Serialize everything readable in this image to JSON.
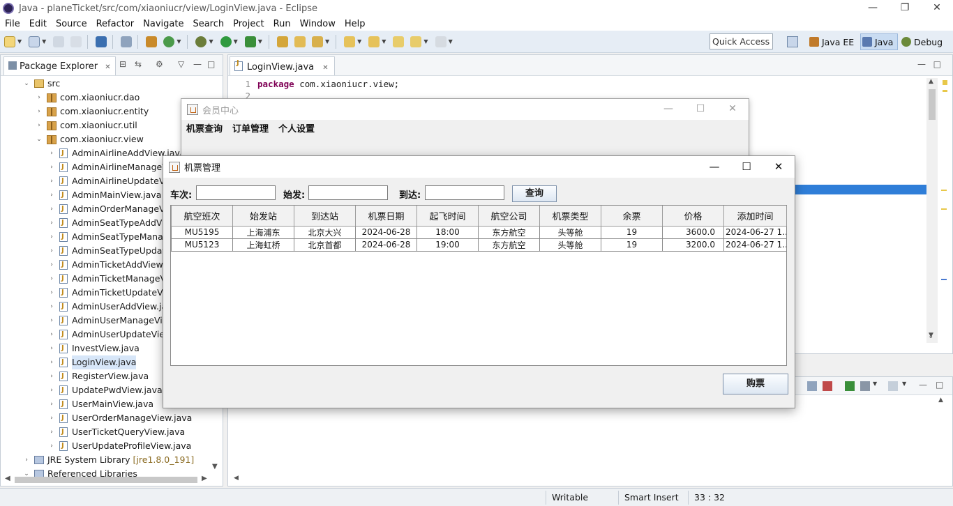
{
  "window": {
    "title": "Java - planeTicket/src/com/xiaoniucr/view/LoginView.java - Eclipse",
    "min_symbol": "—",
    "restore_symbol": "❐",
    "close_symbol": "✕"
  },
  "menu": [
    "File",
    "Edit",
    "Source",
    "Refactor",
    "Navigate",
    "Search",
    "Project",
    "Run",
    "Window",
    "Help"
  ],
  "toolbar": {
    "quick_access": "Quick Access",
    "perspectives": [
      {
        "label": "Java EE",
        "active": false
      },
      {
        "label": "Java",
        "active": true
      },
      {
        "label": "Debug",
        "active": false
      }
    ]
  },
  "package_explorer": {
    "tab_label": "Package Explorer",
    "tree": [
      {
        "label": "src",
        "kind": "src",
        "expanded": true
      },
      {
        "label": "com.xiaoniucr.dao",
        "kind": "pkg"
      },
      {
        "label": "com.xiaoniucr.entity",
        "kind": "pkg"
      },
      {
        "label": "com.xiaoniucr.util",
        "kind": "pkg"
      },
      {
        "label": "com.xiaoniucr.view",
        "kind": "pkg",
        "expanded": true
      },
      {
        "label": "AdminAirlineAddView.java",
        "kind": "java"
      },
      {
        "label": "AdminAirlineManageV",
        "kind": "java"
      },
      {
        "label": "AdminAirlineUpdateVi",
        "kind": "java"
      },
      {
        "label": "AdminMainView.java",
        "kind": "java"
      },
      {
        "label": "AdminOrderManageVi",
        "kind": "java"
      },
      {
        "label": "AdminSeatTypeAddVi",
        "kind": "java"
      },
      {
        "label": "AdminSeatTypeManag",
        "kind": "java"
      },
      {
        "label": "AdminSeatTypeUpdat",
        "kind": "java"
      },
      {
        "label": "AdminTicketAddView.j",
        "kind": "java"
      },
      {
        "label": "AdminTicketManageV",
        "kind": "java"
      },
      {
        "label": "AdminTicketUpdateVi",
        "kind": "java"
      },
      {
        "label": "AdminUserAddView.ja",
        "kind": "java"
      },
      {
        "label": "AdminUserManageVie",
        "kind": "java"
      },
      {
        "label": "AdminUserUpdateView",
        "kind": "java"
      },
      {
        "label": "InvestView.java",
        "kind": "java"
      },
      {
        "label": "LoginView.java",
        "kind": "java",
        "selected": true
      },
      {
        "label": "RegisterView.java",
        "kind": "java"
      },
      {
        "label": "UpdatePwdView.java",
        "kind": "java"
      },
      {
        "label": "UserMainView.java",
        "kind": "java"
      },
      {
        "label": "UserOrderManageView.java",
        "kind": "java"
      },
      {
        "label": "UserTicketQueryView.java",
        "kind": "java"
      },
      {
        "label": "UserUpdateProfileView.java",
        "kind": "java"
      },
      {
        "label": "JRE System Library",
        "version": "[jre1.8.0_191]",
        "kind": "lib"
      },
      {
        "label": "Referenced Libraries",
        "kind": "lib",
        "expanded": true
      }
    ]
  },
  "editor": {
    "tab_label": "LoginView.java",
    "lines": [
      {
        "num": "1",
        "keyword": "package",
        "rest": " com.xiaoniucr.view;"
      },
      {
        "num": "2",
        "keyword": "",
        "rest": ""
      }
    ]
  },
  "status": {
    "writable": "Writable",
    "insert_mode": "Smart Insert",
    "position": "33 : 32"
  },
  "member_window": {
    "title": "会员中心",
    "menu": [
      "机票查询",
      "订单管理",
      "个人设置"
    ]
  },
  "ticket_dialog": {
    "title": "机票管理",
    "search": {
      "train_label": "车次:",
      "train_value": "",
      "from_label": "始发:",
      "from_value": "",
      "to_label": "到达:",
      "to_value": "",
      "query_button": "查询"
    },
    "table": {
      "columns": [
        "航空班次",
        "始发站",
        "到达站",
        "机票日期",
        "起飞时间",
        "航空公司",
        "机票类型",
        "余票",
        "价格",
        "添加时间"
      ],
      "rows": [
        [
          "MU5195",
          "上海浦东",
          "北京大兴",
          "2024-06-28",
          "18:00",
          "东方航空",
          "头等舱",
          "19",
          "3600.0",
          "2024-06-27 1..."
        ],
        [
          "MU5123",
          "上海虹桥",
          "北京首都",
          "2024-06-28",
          "19:00",
          "东方航空",
          "头等舱",
          "19",
          "3200.0",
          "2024-06-27 1..."
        ]
      ]
    },
    "buy_button": "购票"
  },
  "colors": {
    "selection_blue": "#2f7ed8",
    "keyword": "#7f0055",
    "toolbar_bg": "#e6edf5"
  }
}
